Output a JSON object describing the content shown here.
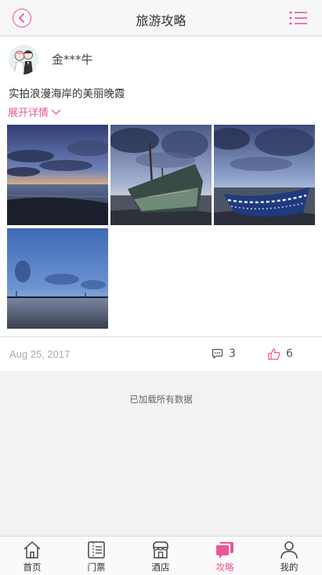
{
  "header": {
    "title": "旅游攻略",
    "back_icon": "back-arrow-icon",
    "menu_icon": "list-menu-icon"
  },
  "post": {
    "username": "金***牛",
    "text": "实拍浪漫海岸的美丽晚霞",
    "expand_label": "展开详情",
    "date": "Aug 25, 2017",
    "comment_count": "3",
    "like_count": "6"
  },
  "feed": {
    "loaded_text": "已加载所有数据"
  },
  "tabbar": {
    "items": [
      {
        "label": "首页",
        "icon": "home-icon"
      },
      {
        "label": "门票",
        "icon": "ticket-icon"
      },
      {
        "label": "酒店",
        "icon": "hotel-icon"
      },
      {
        "label": "攻略",
        "icon": "guide-icon",
        "active": true
      },
      {
        "label": "我的",
        "icon": "person-icon"
      }
    ]
  },
  "colors": {
    "accent": "#e9579a",
    "background": "#f2f2f2"
  }
}
